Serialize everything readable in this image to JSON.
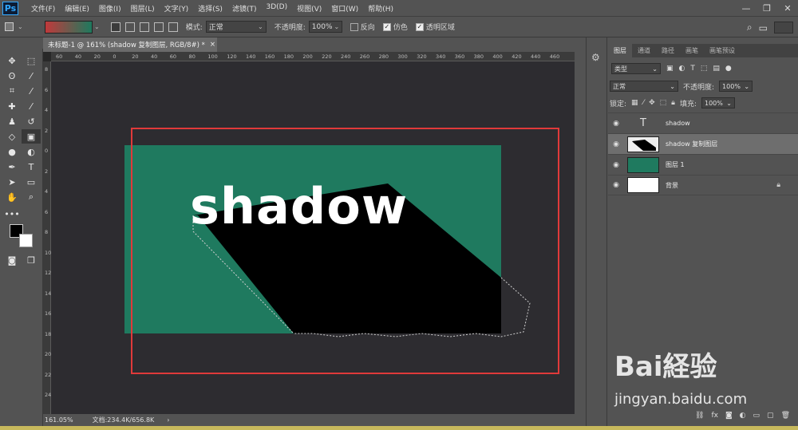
{
  "app": {
    "logo": "Ps"
  },
  "menu": [
    "文件(F)",
    "编辑(E)",
    "图像(I)",
    "图层(L)",
    "文字(Y)",
    "选择(S)",
    "滤镜(T)",
    "3D(D)",
    "视图(V)",
    "窗口(W)",
    "帮助(H)"
  ],
  "window_controls": {
    "minimize": "—",
    "restore": "❐",
    "close": "✕"
  },
  "options": {
    "mode_label": "模式:",
    "mode_value": "正常",
    "opacity_label": "不透明度:",
    "opacity_value": "100%",
    "reverse_label": "反向",
    "dither_label": "仿色",
    "transparency_label": "透明区域",
    "gradient_colors": [
      "#c0393b",
      "#1e7a5e"
    ]
  },
  "document": {
    "tab_title": "未标题-1 @ 161% (shadow 复制图层, RGB/8#) *",
    "close": "×",
    "canvas_text": "shadow",
    "canvas_color": "#1f7a5f",
    "status_zoom": "161.05%",
    "status_doc": "文档:234.4K/656.8K",
    "ruler_top": [
      "60",
      "40",
      "20",
      "0",
      "20",
      "40",
      "60",
      "80",
      "100",
      "120",
      "140",
      "160",
      "180",
      "200",
      "220",
      "240",
      "260",
      "280",
      "300",
      "320",
      "340",
      "360",
      "380",
      "400",
      "420",
      "440",
      "460"
    ],
    "ruler_left": [
      "8",
      "6",
      "4",
      "2",
      "0",
      "2",
      "4",
      "6",
      "8",
      "10",
      "12",
      "14",
      "16",
      "18",
      "20",
      "22",
      "24"
    ]
  },
  "layers_panel": {
    "tabs": [
      "图层",
      "通道",
      "路径",
      "画笔",
      "画笔预设"
    ],
    "filter_kind": "类型",
    "blend_mode": "正常",
    "opacity_label": "不透明度:",
    "opacity_value": "100%",
    "lock_label": "锁定:",
    "fill_label": "填充:",
    "fill_value": "100%",
    "layers": [
      {
        "name": "shadow",
        "type": "text"
      },
      {
        "name": "shadow 复制图层",
        "type": "shape"
      },
      {
        "name": "图层 1",
        "type": "fill"
      },
      {
        "name": "背景",
        "type": "background"
      }
    ]
  },
  "watermark": {
    "brand": "Bai経验",
    "url": "jingyan.baidu.com"
  }
}
